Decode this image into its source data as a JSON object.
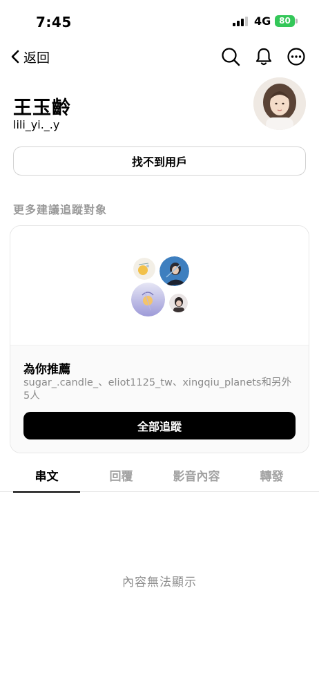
{
  "status_bar": {
    "time": "7:45",
    "network": "4G",
    "battery": "80"
  },
  "nav": {
    "back_label": "返回",
    "icons": [
      "search-icon",
      "bell-icon",
      "more-icon"
    ]
  },
  "profile": {
    "name": "王玉齡",
    "handle": "lili_yi._.y",
    "not_found_label": "找不到用戶"
  },
  "suggestions": {
    "heading": "更多建議追蹤對象",
    "title": "為你推薦",
    "description": "sugar_.candle_、eliot1125_tw、xingqiu_planets和另外5人",
    "follow_all_label": "全部追蹤"
  },
  "tabs": [
    {
      "label": "串文",
      "active": true
    },
    {
      "label": "回覆",
      "active": false
    },
    {
      "label": "影音內容",
      "active": false
    },
    {
      "label": "轉發",
      "active": false
    }
  ],
  "empty_message": "內容無法顯示",
  "colors": {
    "battery": "#34c759",
    "secondary_text": "#8f8f8f",
    "button_dark": "#000000"
  }
}
